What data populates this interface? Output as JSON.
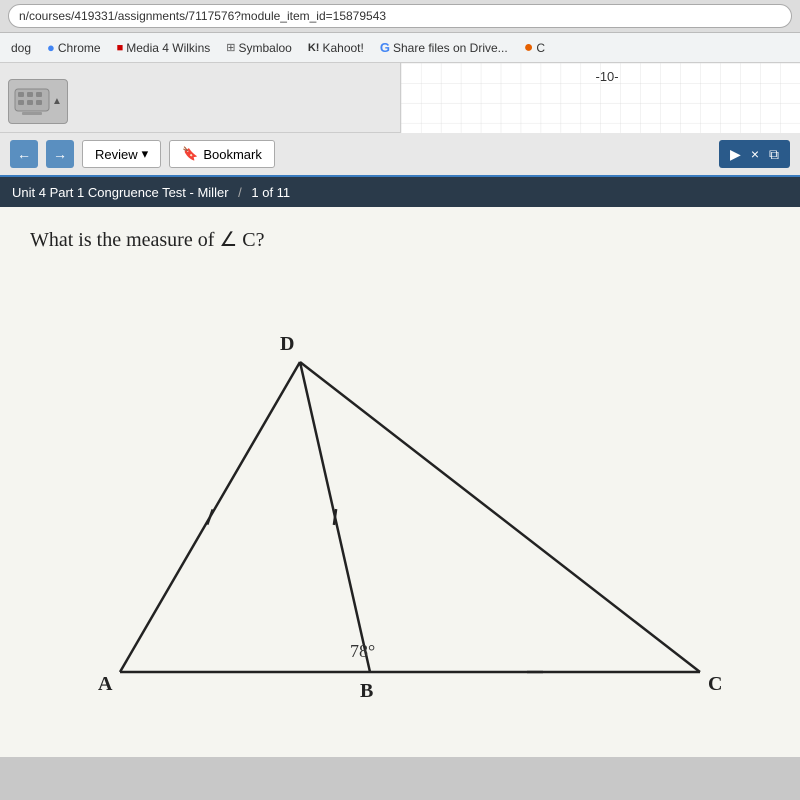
{
  "browser": {
    "url": "n/courses/419331/assignments/7117576?module_item_id=15879543",
    "star_icon": "★",
    "settings_icon": "⚙"
  },
  "bookmarks": [
    {
      "id": "dog",
      "label": "dog",
      "icon_color": "#888",
      "icon_char": ""
    },
    {
      "id": "chrome",
      "label": "Chrome",
      "icon_color": "#4285f4",
      "icon_char": "●"
    },
    {
      "id": "media4wilkins",
      "label": "Media 4 Wilkins",
      "icon_color": "#cc0000",
      "icon_char": "■"
    },
    {
      "id": "symbaloo",
      "label": "Symbaloo",
      "icon_color": "#555",
      "icon_char": "⊞"
    },
    {
      "id": "kahoot",
      "label": "Kahoot!",
      "icon_color": "#333",
      "icon_char": "K!"
    },
    {
      "id": "google-drive",
      "label": "Share files on Drive...",
      "icon_color": "#4285f4",
      "icon_char": "G"
    },
    {
      "id": "more",
      "label": "C",
      "icon_color": "#e66000",
      "icon_char": ""
    }
  ],
  "grid": {
    "label": "-10-"
  },
  "toolbar": {
    "back_label": "←",
    "forward_label": "→",
    "review_label": "Review",
    "review_arrow": "▾",
    "bookmark_icon": "🔖",
    "bookmark_label": "Bookmark",
    "cursor_icon": "▶",
    "close_icon": "×",
    "copy_icon": "⧉"
  },
  "title_bar": {
    "title": "Unit 4 Part 1 Congruence Test - Miller",
    "separator": "/",
    "progress": "1 of 11"
  },
  "question": {
    "text": "What is the measure of ∠ C?",
    "diagram": {
      "angle_label": "78°",
      "vertex_a": "A",
      "vertex_b": "B",
      "vertex_c": "C",
      "vertex_d": "D"
    }
  }
}
